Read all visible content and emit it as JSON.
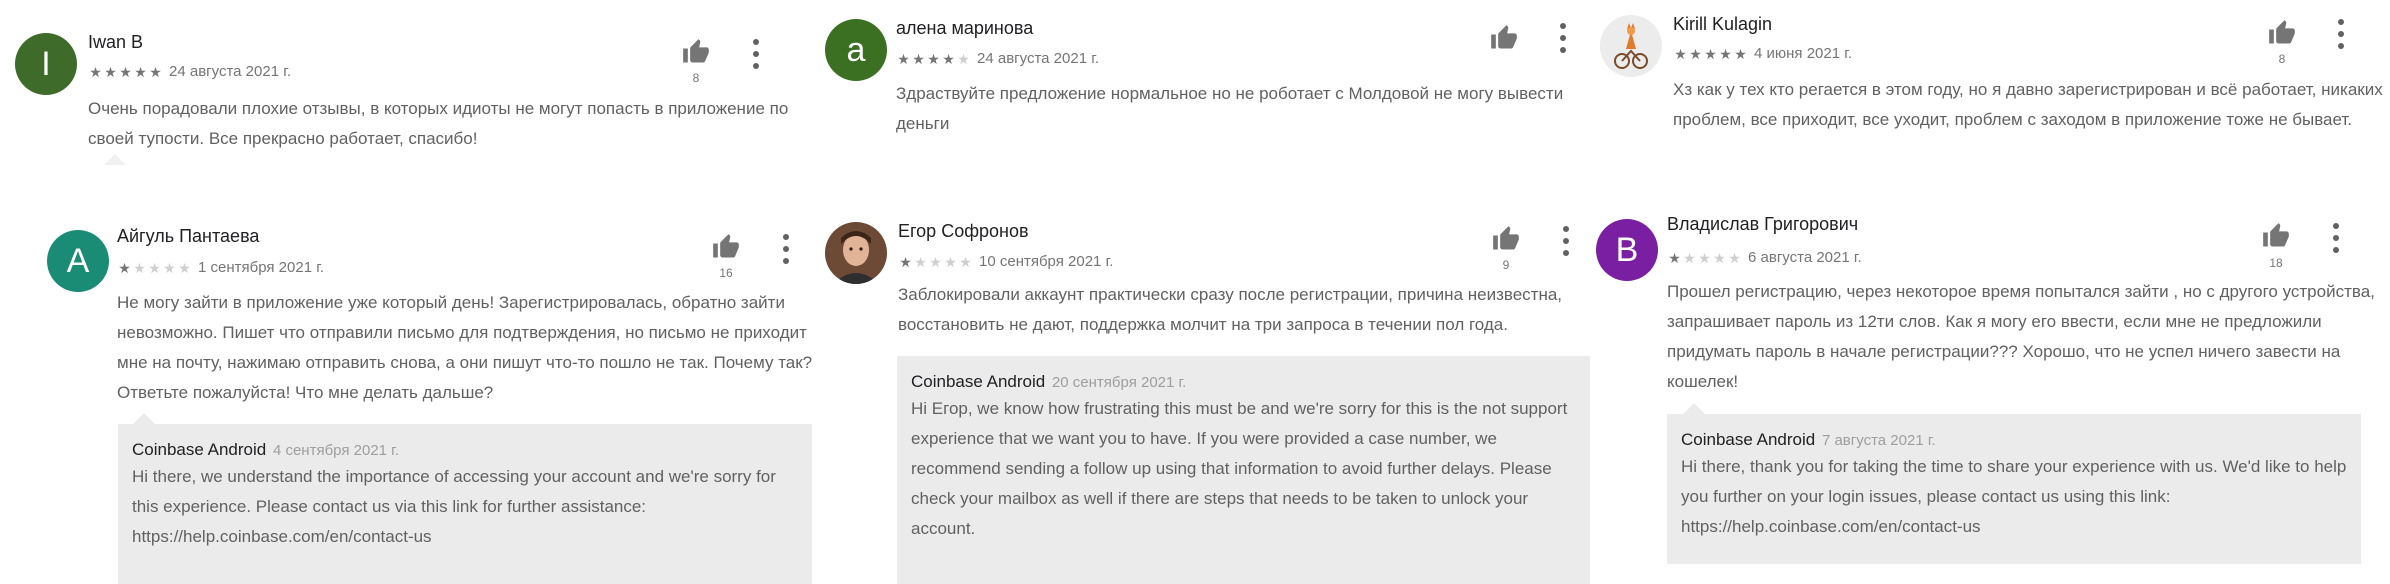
{
  "colors": {
    "star_on": "#757575",
    "star_off": "#cfcfcf",
    "reply_bg": "#ebebeb"
  },
  "reviews": [
    {
      "name": "Iwan B",
      "avatar_letter": "I",
      "avatar_color": "#3e6b2a",
      "rating": 5,
      "date": "24 августа 2021 г.",
      "likes": "8",
      "text": "Очень порадовали плохие отзывы, в которых идиоты не могут попасть в приложение по своей тупости. Все прекрасно работает, спасибо!"
    },
    {
      "name": "алена маринова",
      "avatar_letter": "а",
      "avatar_color": "#3b7022",
      "rating": 4,
      "date": "24 августа 2021 г.",
      "likes": "",
      "text": "Здраствуйте предложение нормальное но не роботает с Молдовой не могу вывести деньги"
    },
    {
      "name": "Kirill Kulagin",
      "avatar_icon": "fox-cyclist-avatar",
      "rating": 5,
      "date": "4 июня 2021 г.",
      "likes": "8",
      "text": "Хз как у тех кто регается в этом году, но я давно зарегистрирован и всё работает, никаких проблем, все приходит, все уходит, проблем с заходом в приложение тоже не бывает."
    },
    {
      "name": "Айгуль Пантаева",
      "avatar_letter": "A",
      "avatar_color": "#1a8c75",
      "rating": 1,
      "date": "1 сентября 2021 г.",
      "likes": "16",
      "text": "Не могу зайти в приложение уже который день! Зарегистрировалась, обратно зайти невозможно. Пишет что отправили письмо для подтверждения, но письмо не приходит мне на почту, нажимаю отправить снова, а они пишут что-то пошло не так. Почему так? Ответьте пожалуйста! Что мне делать дальше?",
      "reply": {
        "author": "Coinbase Android",
        "date": "4 сентября 2021 г.",
        "text": "Hi there, we understand the importance of accessing your account and we're sorry for this experience. Please contact us via this link for further assistance: https://help.coinbase.com/en/contact-us"
      }
    },
    {
      "name": "Егор Софронов",
      "avatar_icon": "person-photo-avatar",
      "rating": 1,
      "date": "10 сентября 2021 г.",
      "likes": "9",
      "text": "Заблокировали аккаунт практически сразу после регистрации, причина неизвестна, восстановить не дают, поддержка молчит на три запроса в течении пол года.",
      "reply": {
        "author": "Coinbase Android",
        "date": "20 сентября 2021 г.",
        "text": "Hi Егор, we know how frustrating this must be and we're sorry for this is the not support experience that we want you to have. If you were provided a case number, we recommend sending a follow up using that information to avoid further delays. Please check your mailbox as well if there are steps that needs to be taken to unlock your account."
      }
    },
    {
      "name": "Владислав Григорович",
      "avatar_letter": "B",
      "avatar_color": "#7b1fa2",
      "rating": 1,
      "date": "6 августа 2021 г.",
      "likes": "18",
      "text": "Прошел регистрацию, через некоторое время попытался зайти , но с другого устройства, запрашивает пароль из 12ти слов. Как я могу его ввести, если мне не предложили придумать пароль в начале регистрации??? Хорошо, что не успел ничего завести на кошелек!",
      "reply": {
        "author": "Coinbase Android",
        "date": "7 августа 2021 г.",
        "text": "Hi there, thank you for taking the time to share your experience with us. We'd like to help you further on your login issues, please contact us using this link: https://help.coinbase.com/en/contact-us"
      }
    }
  ]
}
